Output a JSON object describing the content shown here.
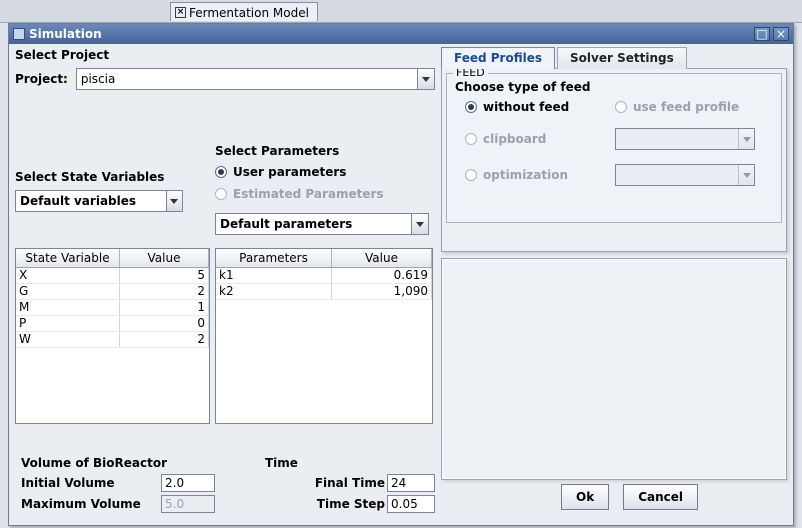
{
  "app_tab": {
    "label": "Fermentation Model"
  },
  "window": {
    "title": "Simulation"
  },
  "left": {
    "select_project_title": "Select Project",
    "project_label": "Project:",
    "project_value": "piscia",
    "select_state_vars_title": "Select State Variables",
    "state_vars_value": "Default variables",
    "state_table": {
      "col1": "State Variable",
      "col2": "Value",
      "rows": [
        {
          "name": "X",
          "value": "5"
        },
        {
          "name": "G",
          "value": "2"
        },
        {
          "name": "M",
          "value": "1"
        },
        {
          "name": "P",
          "value": "0"
        },
        {
          "name": "W",
          "value": "2"
        }
      ]
    },
    "select_params_title": "Select Parameters",
    "radio_user_params": "User parameters",
    "radio_estimated_params": "Estimated Parameters",
    "params_combo_value": "Default parameters",
    "param_table": {
      "col1": "Parameters",
      "col2": "Value",
      "rows": [
        {
          "name": "k1",
          "value": "0.619"
        },
        {
          "name": "k2",
          "value": "1,090"
        }
      ]
    }
  },
  "right": {
    "tab_feed": "Feed Profiles",
    "tab_solver": "Solver Settings",
    "feed_legend": "FEED",
    "choose_label": "Choose type of feed",
    "opt_without": "without feed",
    "opt_useprofile": "use feed profile",
    "opt_clipboard": "clipboard",
    "opt_optimization": "optimization"
  },
  "bottom": {
    "volume_title": "Volume of BioReactor",
    "initial_vol_label": "Initial Volume",
    "initial_vol_value": "2.0",
    "max_vol_label": "Maximum Volume",
    "max_vol_value": "5.0",
    "time_title": "Time",
    "final_time_label": "Final Time",
    "final_time_value": "24",
    "time_step_label": "Time Step",
    "time_step_value": "0.05",
    "ok": "Ok",
    "cancel": "Cancel"
  }
}
